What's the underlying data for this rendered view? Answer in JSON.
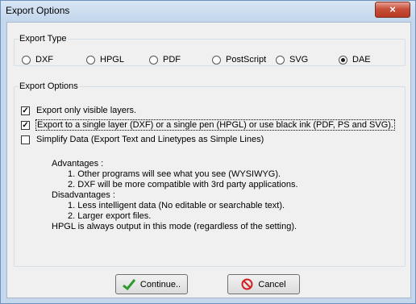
{
  "window": {
    "title": "Export Options",
    "close_symbol": "×"
  },
  "export_type": {
    "legend": "Export Type",
    "options": [
      {
        "label": "DXF",
        "selected": false
      },
      {
        "label": "HPGL",
        "selected": false
      },
      {
        "label": "PDF",
        "selected": false
      },
      {
        "label": "PostScript",
        "selected": false
      },
      {
        "label": "SVG",
        "selected": false
      },
      {
        "label": "DAE",
        "selected": true
      }
    ]
  },
  "export_options": {
    "legend": "Export Options",
    "checkboxes": [
      {
        "label": "Export only visible layers.",
        "checked": true
      },
      {
        "label": "Export to a single layer (DXF) or a single pen (HPGL) or use black ink (PDF, PS and SVG).",
        "checked": true
      },
      {
        "label": "Simplify Data (Export Text and Linetypes as Simple Lines)",
        "checked": false
      }
    ],
    "info": {
      "advantages_heading": "Advantages :",
      "advantages": [
        "1. Other programs will see what you see (WYSIWYG).",
        "2. DXF will be more compatible with 3rd party applications."
      ],
      "disadvantages_heading": "Disadvantages :",
      "disadvantages": [
        "1.  Less intelligent data (No editable or searchable text).",
        "2.  Larger export files."
      ],
      "note": "HPGL is always output in this mode (regardless of the setting)."
    }
  },
  "buttons": {
    "continue_label": "Continue..",
    "cancel_label": "Cancel"
  },
  "colors": {
    "check_green": "#2e9a2e",
    "cancel_red": "#d42020"
  }
}
